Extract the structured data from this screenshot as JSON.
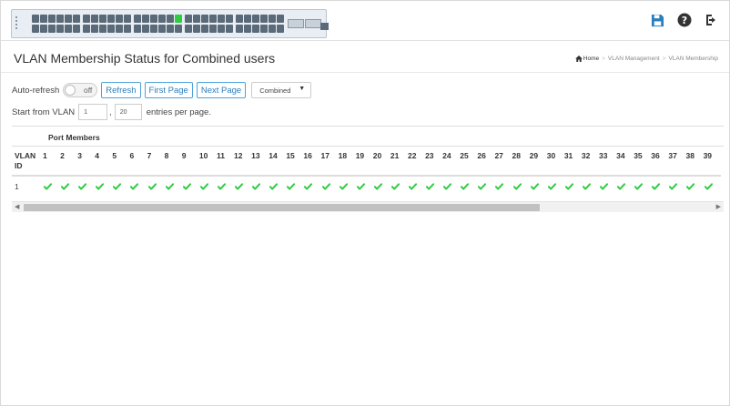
{
  "header": {
    "icons": [
      "save-icon",
      "help-icon",
      "logout-icon"
    ],
    "colors": {
      "accent": "#2a7fbf",
      "save": "#2a7fbf",
      "check": "#2ecc40"
    }
  },
  "title": "VLAN Membership Status for Combined users",
  "breadcrumb": {
    "home": "Home",
    "items": [
      "VLAN Management",
      "VLAN Membership"
    ],
    "separator": ">"
  },
  "controls": {
    "auto_refresh_label": "Auto-refresh",
    "toggle_state": "off",
    "refresh": "Refresh",
    "first_page": "First Page",
    "next_page": "Next Page",
    "user_select": "Combined"
  },
  "start_row": {
    "label": "Start from VLAN",
    "vlan_value": "1",
    "separator": ",",
    "entries_value": "20",
    "after": "entries per page."
  },
  "table": {
    "group_header": "Port Members",
    "vlan_col_line1": "VLAN",
    "vlan_col_line2": "ID",
    "ports": [
      "1",
      "2",
      "3",
      "4",
      "5",
      "6",
      "7",
      "8",
      "9",
      "10",
      "11",
      "12",
      "13",
      "14",
      "15",
      "16",
      "17",
      "18",
      "19",
      "20",
      "21",
      "22",
      "23",
      "24",
      "25",
      "26",
      "27",
      "28",
      "29",
      "30",
      "31",
      "32",
      "33",
      "34",
      "35",
      "36",
      "37",
      "38",
      "39"
    ],
    "rows": [
      {
        "vlan_id": "1",
        "member_icon": "check-icon"
      }
    ]
  }
}
